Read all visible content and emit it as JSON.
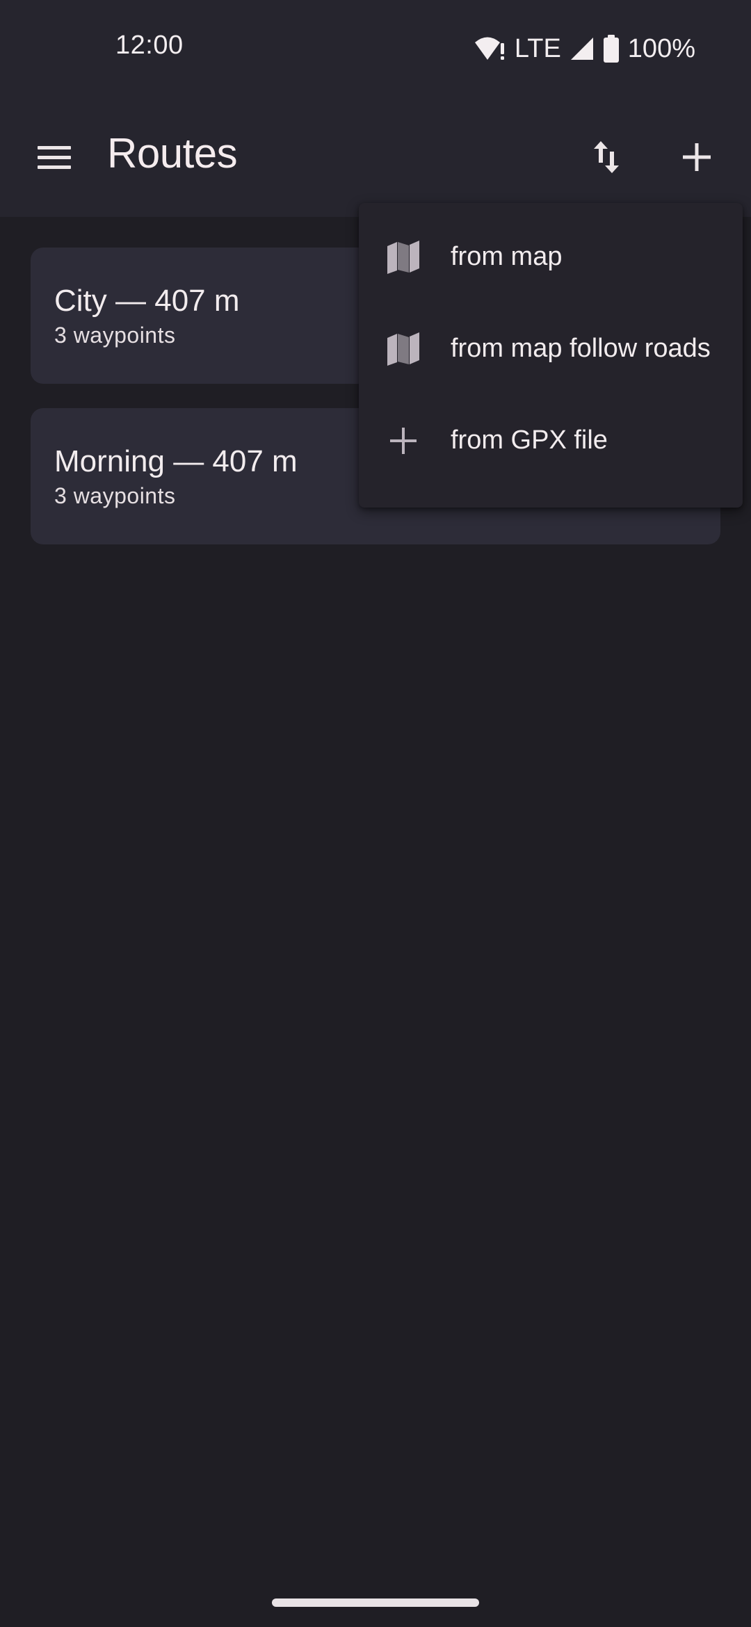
{
  "status_bar": {
    "time": "12:00",
    "network": "LTE",
    "battery": "100%",
    "icons": [
      "wifi-alert-icon",
      "signal-icon",
      "battery-icon"
    ]
  },
  "app_bar": {
    "title": "Routes",
    "icons": {
      "menu": "menu-icon",
      "sort": "sort-icon",
      "add": "add-icon"
    }
  },
  "routes": [
    {
      "title": "City — 407 m",
      "subtitle": "3 waypoints"
    },
    {
      "title": "Morning — 407 m",
      "subtitle": "3 waypoints"
    }
  ],
  "add_menu": {
    "items": [
      {
        "label": "from map",
        "icon": "map-icon"
      },
      {
        "label": "from map follow roads",
        "icon": "map-icon"
      },
      {
        "label": "from GPX file",
        "icon": "add-icon"
      }
    ]
  },
  "colors": {
    "background": "#1f1e24",
    "app_bar": "#26252e",
    "card": "#2d2c38",
    "menu": "#25232b",
    "text": "#f2ecee",
    "icon_muted": "#bcb4bd"
  }
}
